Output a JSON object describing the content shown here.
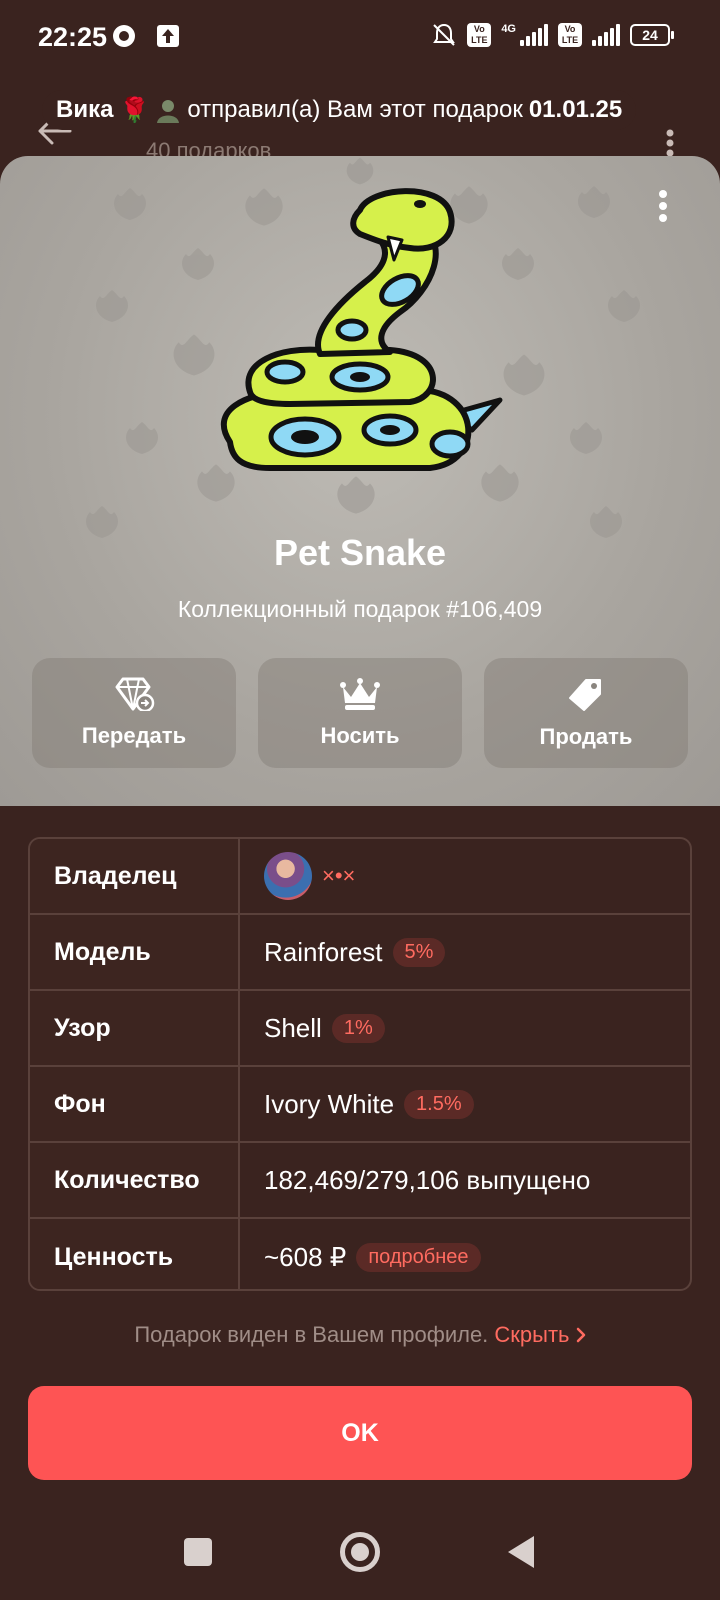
{
  "status_bar": {
    "time": "22:25",
    "network": "4G",
    "volte": "Vo LTE",
    "battery": "24"
  },
  "header": {
    "subtitle": "40 подарков"
  },
  "banner": {
    "sender": "Вика",
    "emoji": "🌹",
    "text": "отправил(а) Вам этот подарок",
    "date": "01.01.25"
  },
  "gift": {
    "title": "Pet Snake",
    "subtitle": "Коллекционный подарок #106,409",
    "icon": "snake-sticker",
    "colors": {
      "body": "#d6f04b",
      "spots": "#8fd9f5",
      "outline": "#111111"
    }
  },
  "actions": [
    {
      "label": "Передать",
      "icon": "diamond-send-icon"
    },
    {
      "label": "Носить",
      "icon": "crown-icon"
    },
    {
      "label": "Продать",
      "icon": "price-tag-icon"
    }
  ],
  "details": {
    "owner": {
      "key": "Владелец",
      "name": "×•×"
    },
    "model": {
      "key": "Модель",
      "value": "Rainforest",
      "badge": "5%"
    },
    "pattern": {
      "key": "Узор",
      "value": "Shell",
      "badge": "1%"
    },
    "background": {
      "key": "Фон",
      "value": "Ivory White",
      "badge": "1.5%"
    },
    "quantity": {
      "key": "Количество",
      "value": "182,469/279,106 выпущено"
    },
    "value": {
      "key": "Ценность",
      "value": "~608 ₽",
      "badge": "подробнее"
    }
  },
  "footer": {
    "note": "Подарок виден в Вашем профиле.",
    "link": "Скрыть"
  },
  "ok_label": "OK",
  "theme": {
    "accent": "#fe5454",
    "background": "#3a231f",
    "badge_text": "#ff6b60"
  }
}
